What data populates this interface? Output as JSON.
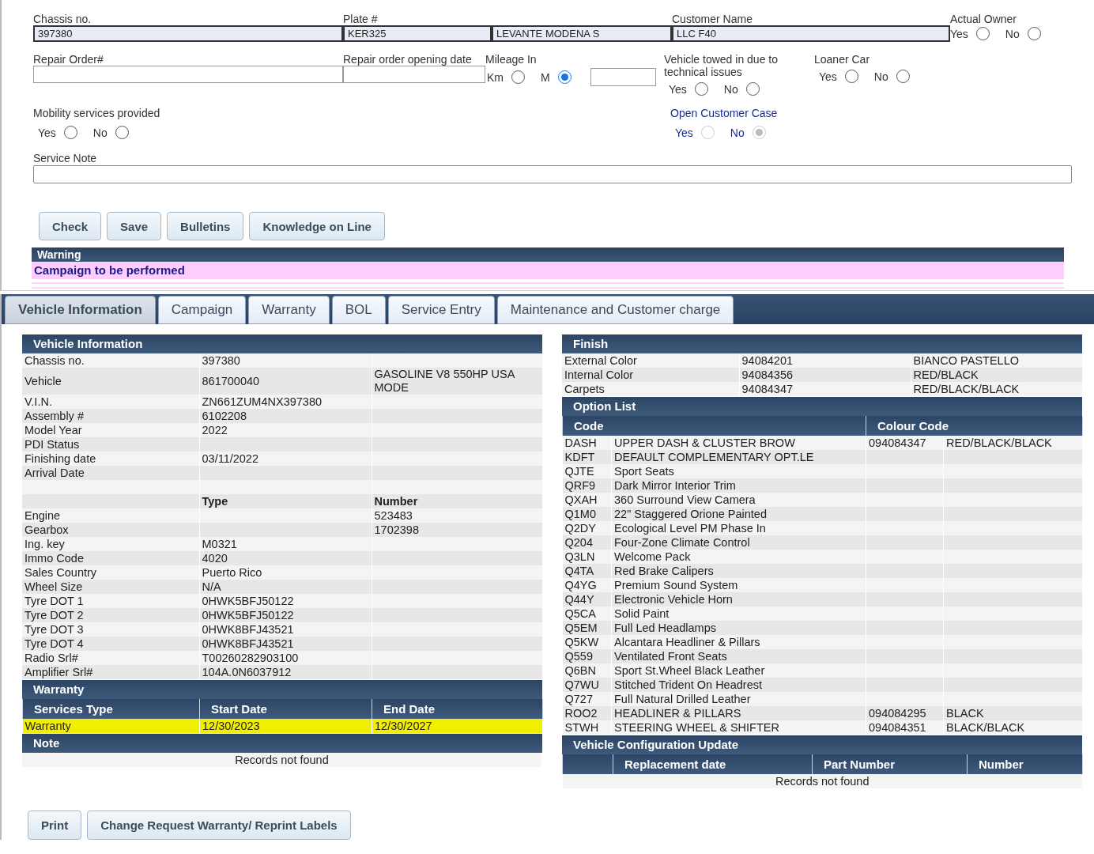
{
  "form_rows": [
    [
      {
        "kind": "field",
        "label": "Chassis no.",
        "value": "397380",
        "readonly": true
      },
      {
        "kind": "field",
        "label": "Plate #",
        "value": "KER325",
        "readonly": true
      },
      {
        "kind": "field",
        "value": "LEVANTE MODENA S",
        "readonly": true
      },
      {
        "kind": "field",
        "label": "Customer Name",
        "value": "LLC F40",
        "readonly": true
      },
      {
        "kind": "radio",
        "label": "Actual Owner",
        "disabled": false,
        "options": [
          {
            "label": "Yes",
            "selected": false
          },
          {
            "label": "No",
            "selected": false
          }
        ]
      }
    ],
    [
      {
        "kind": "field",
        "label": "Repair Order#",
        "readonly": false
      },
      {
        "kind": "field",
        "label": "Repair order opening date",
        "readonly": false
      },
      {
        "kind": "mileage",
        "label": "Mileage In",
        "options": [
          {
            "label": "Km",
            "selected": false
          },
          {
            "label": "M",
            "selected": true
          }
        ]
      },
      {
        "kind": "radio",
        "label": "Vehicle towed in due to technical issues",
        "disabled": false,
        "options": [
          {
            "label": "Yes",
            "selected": false
          },
          {
            "label": "No",
            "selected": false
          }
        ]
      },
      {
        "kind": "radio",
        "label": "Loaner Car",
        "disabled": false,
        "options": [
          {
            "label": "Yes",
            "selected": false
          },
          {
            "label": "No",
            "selected": false
          }
        ]
      }
    ],
    [
      {
        "kind": "radio",
        "label": "Mobility services provided",
        "disabled": false,
        "options": [
          {
            "label": "Yes",
            "selected": false
          },
          {
            "label": "No",
            "selected": false
          }
        ]
      },
      {
        "kind": "radio",
        "label": "Open Customer Case",
        "disabled": true,
        "options": [
          {
            "label": "Yes",
            "selected": false
          },
          {
            "label": "No",
            "selected": true
          }
        ]
      }
    ]
  ],
  "service_note": {
    "label": "Service Note"
  },
  "actions": [
    "Check",
    "Save",
    "Bulletins",
    "Knowledge on Line"
  ],
  "warning": {
    "title": "Warning",
    "message": "Campaign to be performed"
  },
  "tabs": [
    {
      "label": "Vehicle Information",
      "selected": true
    },
    {
      "label": "Campaign",
      "selected": false
    },
    {
      "label": "Warranty",
      "selected": false
    },
    {
      "label": "BOL",
      "selected": false
    },
    {
      "label": "Service Entry",
      "selected": false
    },
    {
      "label": "Maintenance and Customer charge",
      "selected": false
    }
  ],
  "vehicle_information": {
    "title": "Vehicle Information",
    "rows": [
      {
        "kind": "data",
        "label": "Chassis no.",
        "value": "397380"
      },
      {
        "kind": "data",
        "label": "Vehicle",
        "value": "861700040",
        "extra": "GASOLINE V8 550HP USA MODE"
      },
      {
        "kind": "data",
        "label": "V.I.N.",
        "value": "ZN661ZUM4NX397380"
      },
      {
        "kind": "data",
        "label": "Assembly #",
        "value": "6102208"
      },
      {
        "kind": "data",
        "label": "Model Year",
        "value": "2022"
      },
      {
        "kind": "data",
        "label": "PDI Status"
      },
      {
        "kind": "data",
        "label": "Finishing date",
        "value": "03/11/2022"
      },
      {
        "kind": "data",
        "label": "Arrival Date"
      },
      {
        "kind": "blank"
      },
      {
        "kind": "subheader",
        "value": "Type",
        "extra": "Number"
      },
      {
        "kind": "data",
        "label": "Engine",
        "extra": "523483"
      },
      {
        "kind": "data",
        "label": "Gearbox",
        "extra": "1702398"
      },
      {
        "kind": "data",
        "label": "Ing. key",
        "value": "M0321"
      },
      {
        "kind": "data",
        "label": "Immo Code",
        "value": "4020"
      },
      {
        "kind": "data",
        "label": "Sales Country",
        "value": "Puerto Rico"
      },
      {
        "kind": "data",
        "label": "Wheel Size",
        "value": "N/A"
      },
      {
        "kind": "data",
        "label": "Tyre DOT 1",
        "value": "0HWK5BFJ50122"
      },
      {
        "kind": "data",
        "label": "Tyre DOT 2",
        "value": "0HWK5BFJ50122"
      },
      {
        "kind": "data",
        "label": "Tyre DOT 3",
        "value": "0HWK8BFJ43521"
      },
      {
        "kind": "data",
        "label": "Tyre DOT 4",
        "value": "0HWK8BFJ43521"
      },
      {
        "kind": "data",
        "label": "Radio Srl#",
        "value": "T00260282903100"
      },
      {
        "kind": "data",
        "label": "Amplifier Srl#",
        "value": "104A.0N6037912"
      }
    ]
  },
  "warranty": {
    "title": "Warranty",
    "columns": [
      "Services Type",
      "Start Date",
      "End Date"
    ],
    "rows": [
      {
        "cells": [
          "Warranty",
          "12/30/2023",
          "12/30/2027"
        ],
        "highlighted": true
      }
    ]
  },
  "note": {
    "title": "Note",
    "message": "Records not found"
  },
  "bottom_actions": [
    "Print",
    "Change Request Warranty/ Reprint Labels"
  ],
  "finish": {
    "title": "Finish",
    "rows": [
      [
        "External Color",
        "94084201",
        "BIANCO PASTELLO"
      ],
      [
        "Internal Color",
        "94084356",
        "RED/BLACK"
      ],
      [
        "Carpets",
        "94084347",
        "RED/BLACK/BLACK"
      ]
    ]
  },
  "option_list": {
    "title": "Option List",
    "columns": [
      "Code",
      "Colour Code"
    ],
    "rows": [
      {
        "code": "DASH",
        "description": "UPPER DASH & CLUSTER BROW",
        "colour_code": "094084347",
        "colour": "RED/BLACK/BLACK"
      },
      {
        "code": "KDFT",
        "description": "DEFAULT COMPLEMENTARY OPT.LE"
      },
      {
        "code": "QJTE",
        "description": "Sport Seats"
      },
      {
        "code": "QRF9",
        "description": "Dark Mirror Interior Trim"
      },
      {
        "code": "QXAH",
        "description": "360 Surround View Camera"
      },
      {
        "code": "Q1M0",
        "description": "22\" Staggered Orione Painted"
      },
      {
        "code": "Q2DY",
        "description": "Ecological Level PM Phase In"
      },
      {
        "code": "Q204",
        "description": "Four-Zone Climate Control"
      },
      {
        "code": "Q3LN",
        "description": "Welcome Pack"
      },
      {
        "code": "Q4TA",
        "description": "Red Brake Calipers"
      },
      {
        "code": "Q4YG",
        "description": "Premium Sound System"
      },
      {
        "code": "Q44Y",
        "description": "Electronic Vehicle Horn"
      },
      {
        "code": "Q5CA",
        "description": "Solid Paint"
      },
      {
        "code": "Q5EM",
        "description": "Full Led Headlamps"
      },
      {
        "code": "Q5KW",
        "description": "Alcantara Headliner & Pillars"
      },
      {
        "code": "Q559",
        "description": "Ventilated Front Seats"
      },
      {
        "code": "Q6BN",
        "description": "Sport St.Wheel Black Leather"
      },
      {
        "code": "Q7WU",
        "description": "Stitched Trident On Headrest"
      },
      {
        "code": "Q727",
        "description": "Full Natural Drilled Leather"
      },
      {
        "code": "ROO2",
        "description": "HEADLINER & PILLARS",
        "colour_code": "094084295",
        "colour": "BLACK"
      },
      {
        "code": "STWH",
        "description": "STEERING WHEEL & SHIFTER",
        "colour_code": "094084351",
        "colour": "BLACK/BLACK"
      }
    ]
  },
  "configuration_update": {
    "title": "Vehicle Configuration Update",
    "columns": [
      "Replacement date",
      "Part Number",
      "Number"
    ],
    "message": "Records not found"
  }
}
